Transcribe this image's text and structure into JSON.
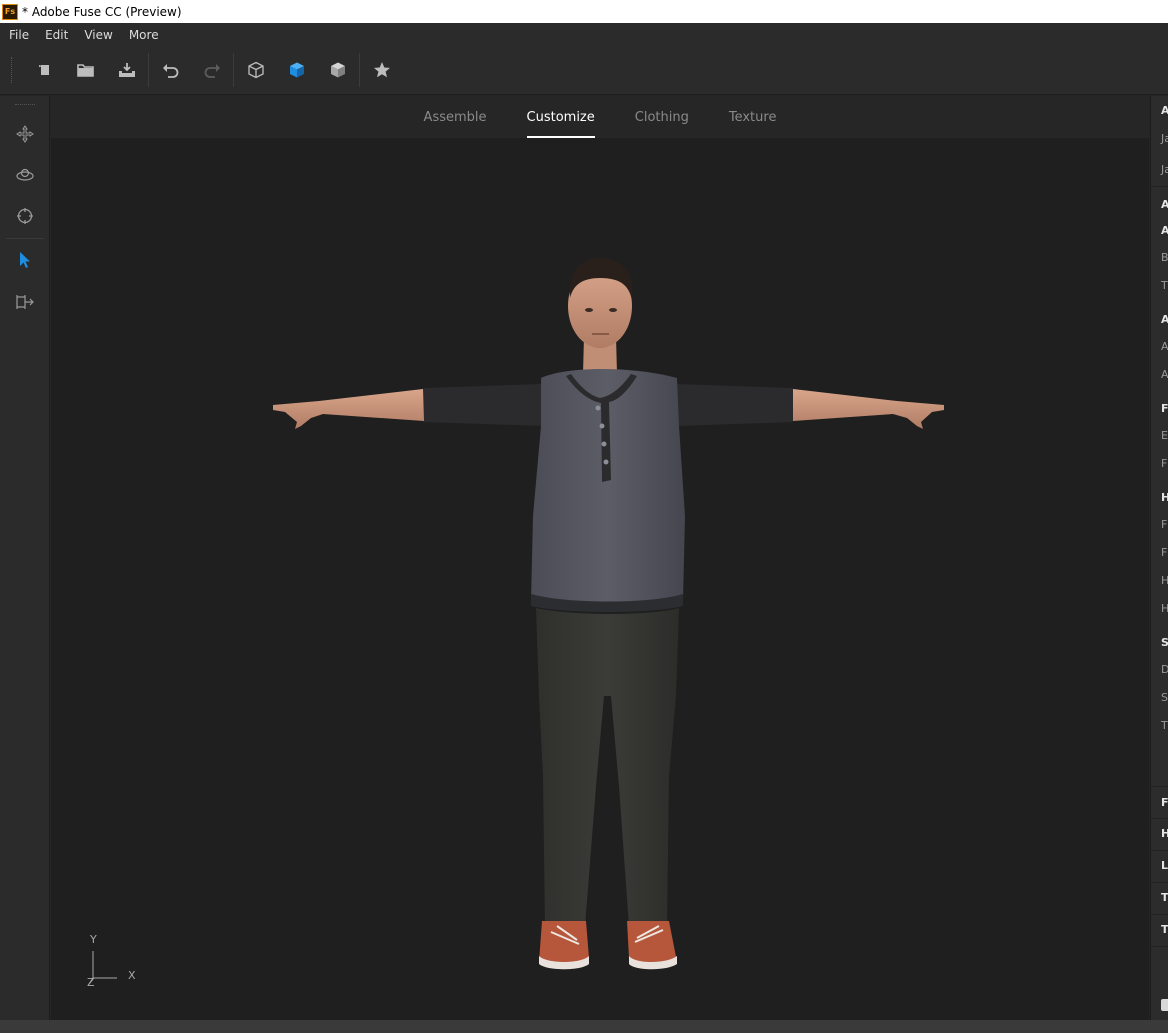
{
  "window": {
    "title": "* Adobe Fuse CC (Preview)",
    "app_icon_text": "Fs"
  },
  "menu": [
    "File",
    "Edit",
    "View",
    "More"
  ],
  "toolbar": {
    "buttons": [
      "new-icon",
      "open-folder-icon",
      "export-icon",
      "undo-icon",
      "redo-icon",
      "wireframe-cube-icon",
      "solid-cube-icon",
      "textured-cube-icon",
      "star-icon"
    ],
    "accent": "#1f8de0"
  },
  "left_tools": [
    "move-icon",
    "orbit-icon",
    "target-icon",
    "select-arrow-icon",
    "pose-icon"
  ],
  "tabs": [
    {
      "label": "Assemble",
      "active": false
    },
    {
      "label": "Customize",
      "active": true
    },
    {
      "label": "Clothing",
      "active": false
    },
    {
      "label": "Texture",
      "active": false
    }
  ],
  "axes": {
    "y": "Y",
    "x": "X",
    "z": "Z"
  },
  "right_panel": {
    "rows": [
      {
        "text": "A",
        "kind": "h"
      },
      {
        "text": "Ja",
        "kind": "s"
      },
      {
        "text": "Ja",
        "kind": "s"
      },
      {
        "text": "A",
        "kind": "h"
      },
      {
        "text": "A",
        "kind": "h"
      },
      {
        "text": "B",
        "kind": "s"
      },
      {
        "text": "T",
        "kind": "s"
      },
      {
        "text": "A",
        "kind": "h"
      },
      {
        "text": "A",
        "kind": "s"
      },
      {
        "text": "A",
        "kind": "s"
      },
      {
        "text": "F",
        "kind": "h"
      },
      {
        "text": "E",
        "kind": "s"
      },
      {
        "text": "F",
        "kind": "s"
      },
      {
        "text": "H",
        "kind": "h"
      },
      {
        "text": "F",
        "kind": "s"
      },
      {
        "text": "F",
        "kind": "s"
      },
      {
        "text": "H",
        "kind": "s"
      },
      {
        "text": "H",
        "kind": "s"
      },
      {
        "text": "S",
        "kind": "h"
      },
      {
        "text": "D",
        "kind": "s"
      },
      {
        "text": "S",
        "kind": "s"
      },
      {
        "text": "T",
        "kind": "s"
      },
      {
        "text": "F",
        "kind": "h"
      },
      {
        "text": "H",
        "kind": "h"
      },
      {
        "text": "LI",
        "kind": "h"
      },
      {
        "text": "T",
        "kind": "h"
      },
      {
        "text": "T",
        "kind": "h"
      }
    ]
  }
}
